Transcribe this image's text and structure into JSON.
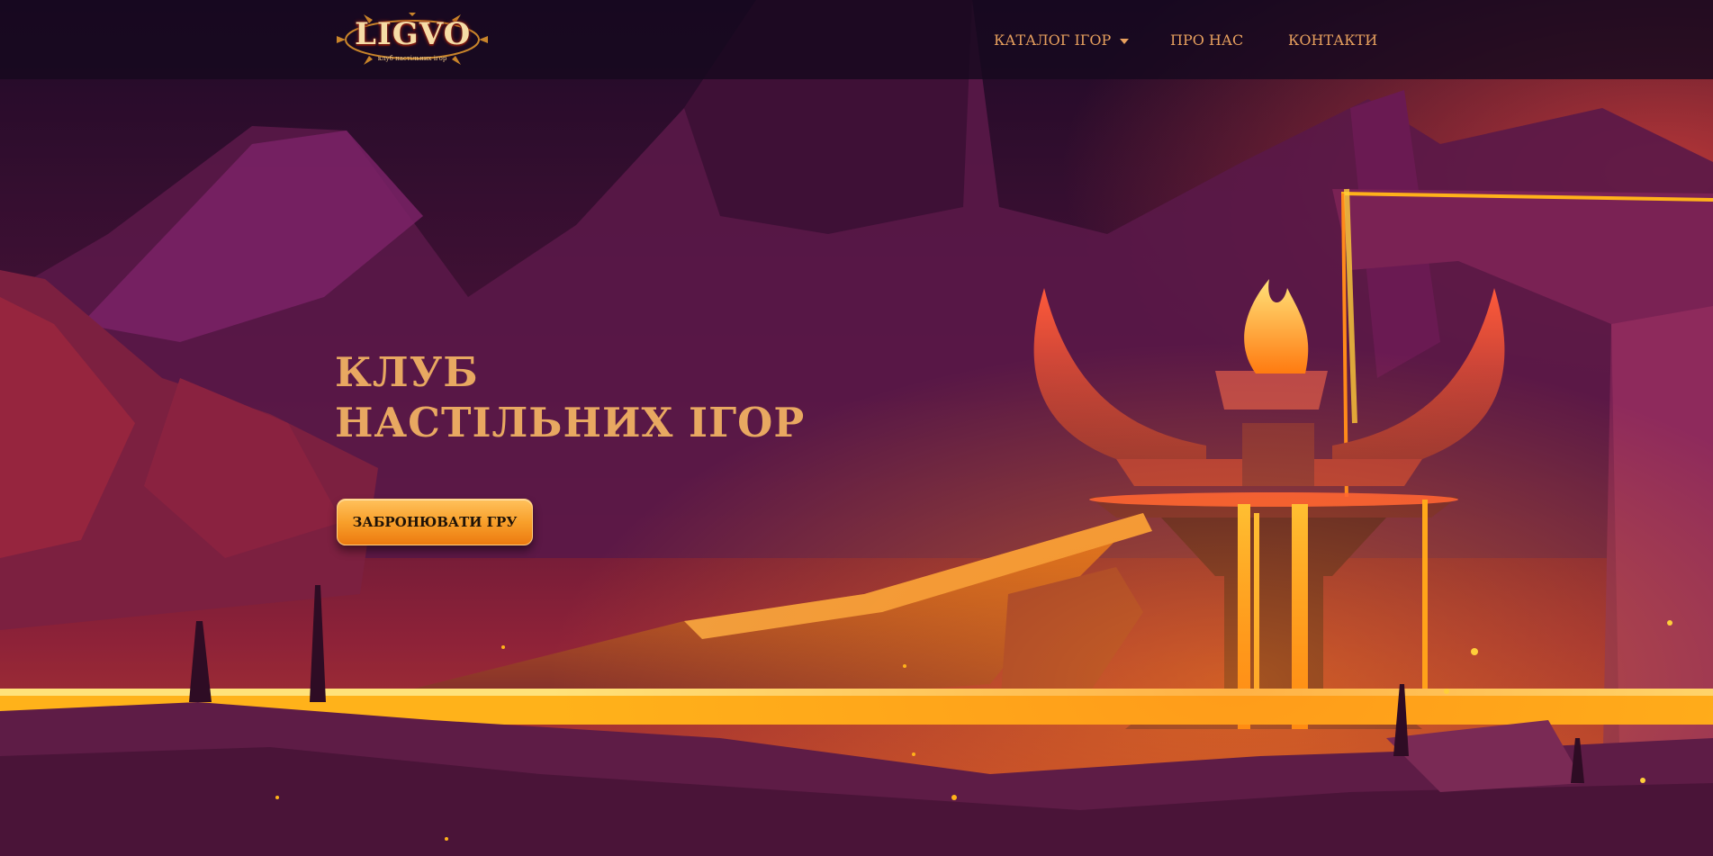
{
  "header": {
    "logo_text": "LIGVO",
    "logo_tagline": "клуб настільних ігор",
    "nav": {
      "catalog_label": "КАТАЛОГ ІГОР",
      "about_label": "ПРО НАС",
      "contacts_label": "КОНТАКТИ"
    }
  },
  "hero": {
    "title_line1": "КЛУБ",
    "title_line2": "НАСТІЛЬНИХ ІГОР",
    "cta_label": "ЗАБРОНЮВАТИ ГРУ"
  },
  "icons": {
    "catalog_dropdown": "chevron-down-icon",
    "logo_emblem": "sun-emblem"
  },
  "colors": {
    "accent": "#e8a861",
    "nav_text": "#e7a05e",
    "button_top": "#ffc15c",
    "button_bottom": "#ec7a10",
    "lava": "#ffb21a",
    "background": "#2a0d2e"
  }
}
